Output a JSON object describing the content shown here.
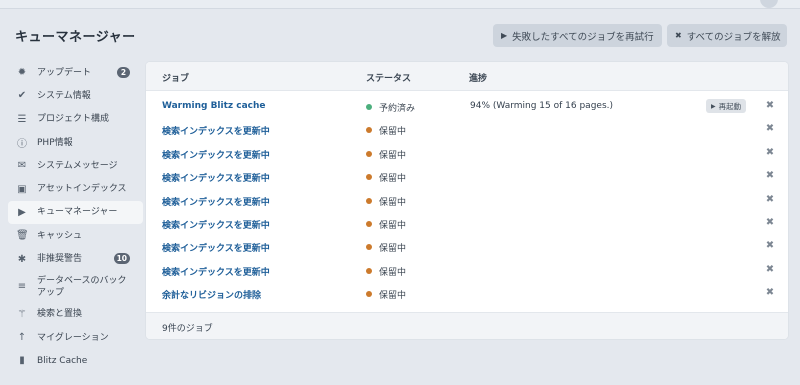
{
  "header": {
    "title": "キューマネージャー",
    "retry_all_label": "失敗したすべてのジョブを再試行",
    "release_all_label": "すべてのジョブを解放"
  },
  "sidebar": {
    "items": [
      {
        "label": "アップデート",
        "icon": "gear-icon",
        "badge": "2"
      },
      {
        "label": "システム情報",
        "icon": "check-icon"
      },
      {
        "label": "プロジェクト構成",
        "icon": "sliders-icon"
      },
      {
        "label": "PHP情報",
        "icon": "info-icon"
      },
      {
        "label": "システムメッセージ",
        "icon": "envelope-icon"
      },
      {
        "label": "アセットインデックス",
        "icon": "image-icon"
      },
      {
        "label": "キューマネージャー",
        "icon": "play-icon",
        "active": true
      },
      {
        "label": "キャッシュ",
        "icon": "trash-icon"
      },
      {
        "label": "非推奨警告",
        "icon": "bug-icon",
        "badge": "10"
      },
      {
        "label": "データベースのバックアップ",
        "icon": "database-icon"
      },
      {
        "label": "検索と置換",
        "icon": "magic-wand-icon"
      },
      {
        "label": "マイグレーション",
        "icon": "arrow-up-icon"
      },
      {
        "label": "Blitz Cache",
        "icon": "blitz-icon"
      }
    ]
  },
  "table": {
    "headers": {
      "job": "ジョブ",
      "status": "ステータス",
      "progress": "進捗"
    },
    "rows": [
      {
        "title": "Warming Blitz cache",
        "status": "予約済み",
        "status_color": "#4caf7d",
        "progress": "94% (Warming 15 of 16 pages.)",
        "action": "再起動"
      },
      {
        "title": "検索インデックスを更新中",
        "status": "保留中",
        "status_color": "#cc7a2c",
        "progress": ""
      },
      {
        "title": "検索インデックスを更新中",
        "status": "保留中",
        "status_color": "#cc7a2c",
        "progress": ""
      },
      {
        "title": "検索インデックスを更新中",
        "status": "保留中",
        "status_color": "#cc7a2c",
        "progress": ""
      },
      {
        "title": "検索インデックスを更新中",
        "status": "保留中",
        "status_color": "#cc7a2c",
        "progress": ""
      },
      {
        "title": "検索インデックスを更新中",
        "status": "保留中",
        "status_color": "#cc7a2c",
        "progress": ""
      },
      {
        "title": "検索インデックスを更新中",
        "status": "保留中",
        "status_color": "#cc7a2c",
        "progress": ""
      },
      {
        "title": "検索インデックスを更新中",
        "status": "保留中",
        "status_color": "#cc7a2c",
        "progress": ""
      },
      {
        "title": "余計なリビジョンの排除",
        "status": "保留中",
        "status_color": "#cc7a2c",
        "progress": ""
      }
    ],
    "footer": "9件のジョブ"
  }
}
